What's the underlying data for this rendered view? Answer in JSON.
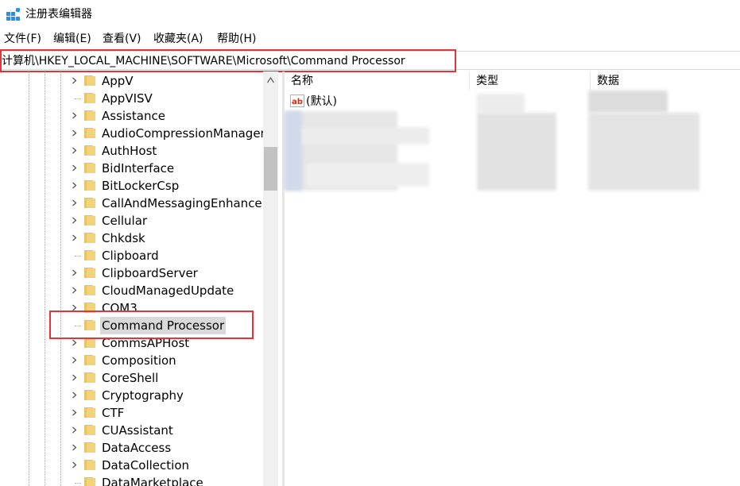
{
  "window": {
    "title": "注册表编辑器"
  },
  "menu": [
    "文件(F)",
    "编辑(E)",
    "查看(V)",
    "收藏夹(A)",
    "帮助(H)"
  ],
  "address": {
    "path": "计算机\\HKEY_LOCAL_MACHINE\\SOFTWARE\\Microsoft\\Command Processor"
  },
  "tree": {
    "items": [
      {
        "label": "AppV",
        "expandable": true
      },
      {
        "label": "AppVISV",
        "expandable": false
      },
      {
        "label": "Assistance",
        "expandable": true
      },
      {
        "label": "AudioCompressionManager",
        "expandable": true
      },
      {
        "label": "AuthHost",
        "expandable": true
      },
      {
        "label": "BidInterface",
        "expandable": true
      },
      {
        "label": "BitLockerCsp",
        "expandable": true
      },
      {
        "label": "CallAndMessagingEnhancement",
        "expandable": true
      },
      {
        "label": "Cellular",
        "expandable": true
      },
      {
        "label": "Chkdsk",
        "expandable": true
      },
      {
        "label": "Clipboard",
        "expandable": false
      },
      {
        "label": "ClipboardServer",
        "expandable": true
      },
      {
        "label": "CloudManagedUpdate",
        "expandable": true
      },
      {
        "label": "COM3",
        "expandable": true
      },
      {
        "label": "Command Processor",
        "expandable": false,
        "selected": true
      },
      {
        "label": "CommsAPHost",
        "expandable": true
      },
      {
        "label": "Composition",
        "expandable": true
      },
      {
        "label": "CoreShell",
        "expandable": true
      },
      {
        "label": "Cryptography",
        "expandable": true
      },
      {
        "label": "CTF",
        "expandable": true
      },
      {
        "label": "CUAssistant",
        "expandable": true
      },
      {
        "label": "DataAccess",
        "expandable": true
      },
      {
        "label": "DataCollection",
        "expandable": true
      },
      {
        "label": "DataMarketplace",
        "expandable": false
      }
    ]
  },
  "list": {
    "columns": [
      "名称",
      "类型",
      "数据"
    ],
    "rows": [
      {
        "name": "(默认)"
      }
    ]
  },
  "colors": {
    "highlight_box": "#e0353a",
    "folder": "#e8c263",
    "selection": "#d9d9d9"
  }
}
